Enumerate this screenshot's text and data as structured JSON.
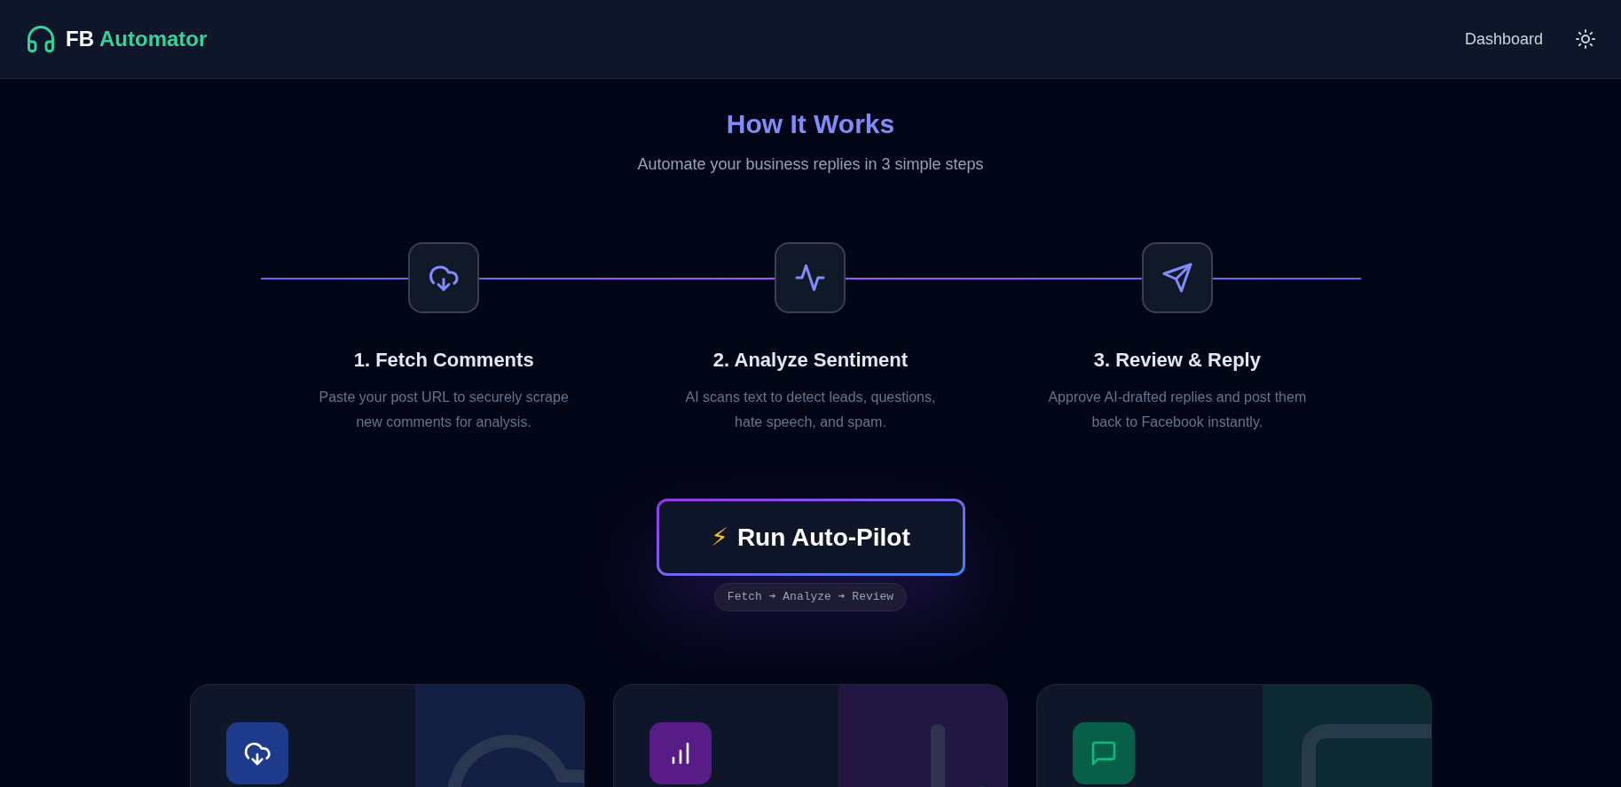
{
  "brand": {
    "first": "FB",
    "second": "Automator"
  },
  "nav": {
    "links": [
      "Dashboard"
    ]
  },
  "hero": {
    "title": "How It Works",
    "subtitle": "Automate your business replies in 3 simple steps"
  },
  "steps": [
    {
      "kind": "download",
      "title": "1. Fetch Comments",
      "description": "Paste your post URL to securely scrape new comments for analysis."
    },
    {
      "kind": "pulse",
      "title": "2. Analyze Sentiment",
      "description": "AI scans text to detect leads, questions, hate speech, and spam."
    },
    {
      "kind": "send",
      "title": "3. Review & Reply",
      "description": "Approve AI-drafted replies and post them back to Facebook instantly."
    }
  ],
  "cta": {
    "icon": "⚡",
    "label": "Run Auto-Pilot",
    "flow": "Fetch ➔ Analyze ➔ Review"
  },
  "cards": [
    {
      "kind": "download",
      "color": "#1e3a8a"
    },
    {
      "kind": "chart",
      "color": "#581c87"
    },
    {
      "kind": "message",
      "color": "#065f46"
    }
  ]
}
